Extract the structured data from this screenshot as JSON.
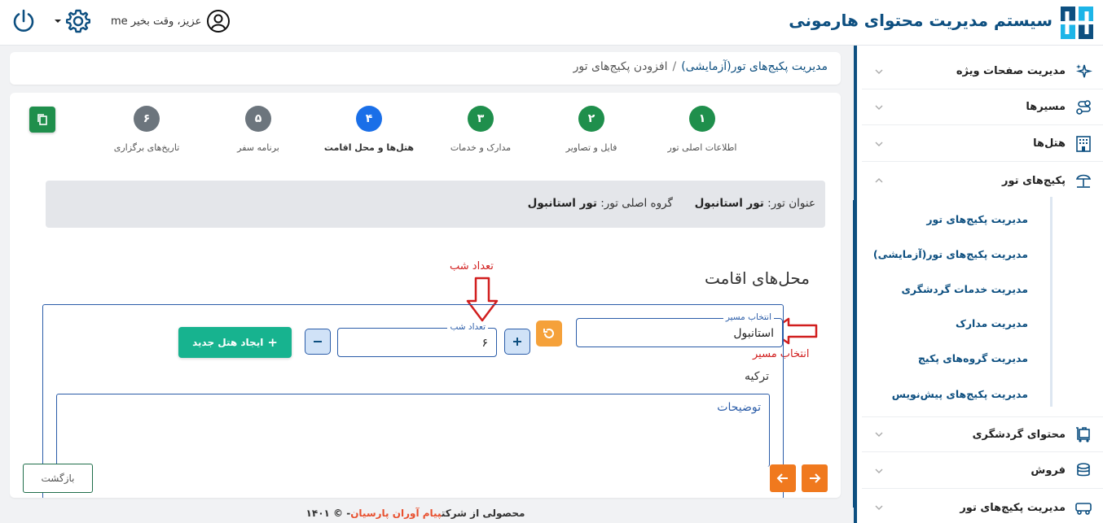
{
  "header": {
    "brand_title": "سیستم مدیریت محتوای هارمونی",
    "greeting": "me عزیز، وقت بخیر"
  },
  "breadcrumb": {
    "link": "مدیریت پکیج‌های تور(آزمایشی)",
    "separator": "/",
    "current": "افزودن پکیج‌های تور"
  },
  "steps": [
    {
      "number": "۱",
      "label": "اطلاعات اصلی تور",
      "color": "#1f8f4c"
    },
    {
      "number": "۲",
      "label": "فایل و تصاویر",
      "color": "#1f8f4c"
    },
    {
      "number": "۳",
      "label": "مدارک و خدمات",
      "color": "#1f8f4c"
    },
    {
      "number": "۴",
      "label": "هتل‌ها و محل اقامت",
      "color": "#1a6fe8"
    },
    {
      "number": "۵",
      "label": "برنامه سفر",
      "color": "#6c757d"
    },
    {
      "number": "۶",
      "label": "تاریخ‌های برگزاری",
      "color": "#6c757d"
    }
  ],
  "info": {
    "title_label": "عنوان تور:",
    "title_value": "تور استانبول",
    "group_label": "گروه اصلی تور:",
    "group_value": "تور استانبول"
  },
  "section_title": "محل‌های اقامت",
  "annotations": {
    "nights": "تعداد شب",
    "route": "انتخاب مسیر"
  },
  "hotel_form": {
    "route_label": "انتخاب مسیر",
    "route_value": "استانبول",
    "nights_label": "تعداد شب",
    "nights_value": "۶",
    "create_hotel": "ایجاد هتل جدید",
    "country": "ترکیه",
    "description_label": "توضیحات"
  },
  "buttons": {
    "back": "بازگشت"
  },
  "sidebar": {
    "items": [
      {
        "label": "مدیریت صفحات ویژه"
      },
      {
        "label": "مسیرها"
      },
      {
        "label": "هتل‌ها"
      },
      {
        "label": "پکیج‌های تور"
      },
      {
        "label": "محتوای گردشگری"
      },
      {
        "label": "فروش"
      },
      {
        "label": "مدیریت پکیج‌های تور"
      }
    ],
    "submenu": [
      "مدیریت پکیج‌های تور",
      "مدیریت پکیج‌های تور(آزمایشی)",
      "مدیریت خدمات گردشگری",
      "مدیریت مدارک",
      "مدیریت گروه‌های پکیج",
      "مدیریت پکیج‌های پیش‌نویس"
    ]
  },
  "footer": {
    "prefix": "محصولی از شرکت",
    "company": "پیام آوران پارسیان",
    "suffix": "- © ۱۴۰۱"
  },
  "colors": {
    "brand": "#0d4f80",
    "success": "#1f8f4c",
    "active_step": "#1a6fe8",
    "pending_step": "#6c757d",
    "accent_orange": "#f0791e",
    "teal": "#17b38f",
    "annotation_red": "#d11e1e"
  }
}
